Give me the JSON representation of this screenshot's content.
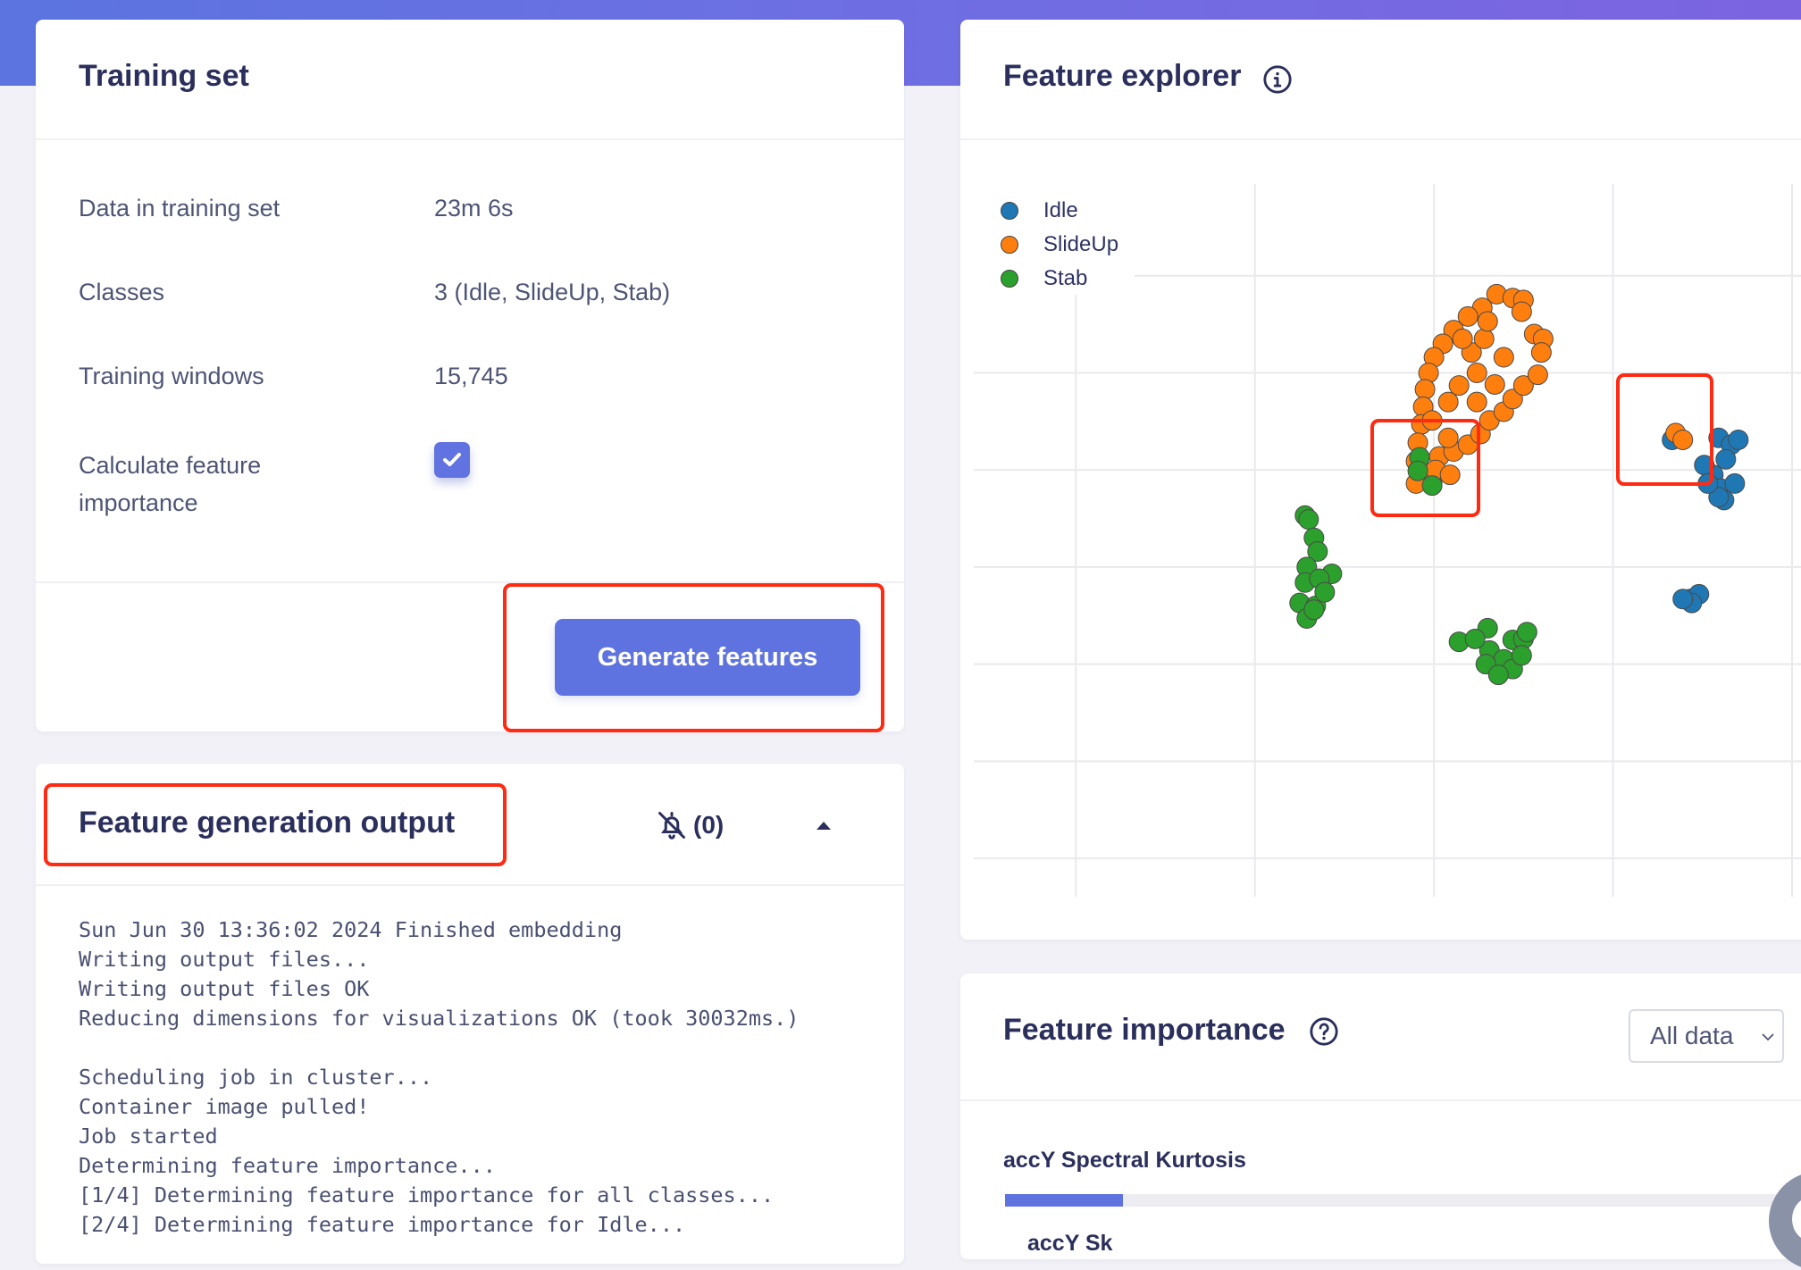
{
  "training_set": {
    "title": "Training set",
    "rows": [
      {
        "label": "Data in training set",
        "value": "23m 6s"
      },
      {
        "label": "Classes",
        "value": "3 (Idle, SlideUp, Stab)"
      },
      {
        "label": "Training windows",
        "value": "15,745"
      }
    ],
    "feature_importance_label_line1": "Calculate feature",
    "feature_importance_label_line2": "importance",
    "feature_importance_checked": true,
    "generate_button": "Generate features"
  },
  "output": {
    "title": "Feature generation output",
    "notification_icon": "bell-off-icon",
    "notification_count": "(0)",
    "collapse_icon": "caret-up-icon",
    "log_lines": [
      "Sun Jun 30 13:36:02 2024 Finished embedding",
      "Writing output files...",
      "Writing output files OK",
      "Reducing dimensions for visualizations OK (took 30032ms.)",
      "",
      "Scheduling job in cluster...",
      "Container image pulled!",
      "Job started",
      "Determining feature importance...",
      "[1/4] Determining feature importance for all classes...",
      "[2/4] Determining feature importance for Idle..."
    ]
  },
  "feature_explorer": {
    "title": "Feature explorer",
    "info_icon": "info-icon"
  },
  "feature_importance": {
    "title": "Feature importance",
    "help_icon": "help-icon",
    "filter_selected": "All data",
    "items": [
      {
        "label": "accY Spectral Kurtosis",
        "importance": 0.15
      },
      {
        "label": "accY Sk",
        "importance": null
      }
    ]
  },
  "colors": {
    "accent": "#5f73e0",
    "idle": "#1f77b4",
    "slideup": "#ff7f0e",
    "stab": "#2ca02c",
    "highlight": "#ff2a12"
  },
  "chart_data": {
    "type": "scatter",
    "title": "",
    "xlabel": "",
    "ylabel": "",
    "xlim": [
      -0.57,
      4.05
    ],
    "ylim": [
      -0.45,
      7.0
    ],
    "grid": true,
    "x_gridlines": [
      0,
      1,
      2,
      3,
      4
    ],
    "y_gridlines": [
      0,
      1,
      2,
      3,
      4,
      5,
      6
    ],
    "legend": "top-left",
    "series": [
      {
        "name": "Idle",
        "color": "#1f77b4",
        "points": [
          [
            3.33,
            4.31
          ],
          [
            3.59,
            4.33
          ],
          [
            3.66,
            4.26
          ],
          [
            3.7,
            4.31
          ],
          [
            3.63,
            4.11
          ],
          [
            3.56,
            3.95
          ],
          [
            3.6,
            3.81
          ],
          [
            3.62,
            3.69
          ],
          [
            3.59,
            3.72
          ],
          [
            3.51,
            4.05
          ],
          [
            3.53,
            3.86
          ],
          [
            3.68,
            3.86
          ],
          [
            3.43,
            2.67
          ],
          [
            3.48,
            2.72
          ],
          [
            3.44,
            2.63
          ],
          [
            3.39,
            2.67
          ]
        ]
      },
      {
        "name": "SlideUp",
        "color": "#ff7f0e",
        "points": [
          [
            2.35,
            5.81
          ],
          [
            2.44,
            5.77
          ],
          [
            2.5,
            5.75
          ],
          [
            2.27,
            5.67
          ],
          [
            2.19,
            5.58
          ],
          [
            2.11,
            5.44
          ],
          [
            2.05,
            5.3
          ],
          [
            2.0,
            5.16
          ],
          [
            1.97,
            5.0
          ],
          [
            1.95,
            4.83
          ],
          [
            1.94,
            4.65
          ],
          [
            1.93,
            4.47
          ],
          [
            1.91,
            4.28
          ],
          [
            1.9,
            4.09
          ],
          [
            2.03,
            4.14
          ],
          [
            2.11,
            4.19
          ],
          [
            2.19,
            4.26
          ],
          [
            2.26,
            4.37
          ],
          [
            2.31,
            4.51
          ],
          [
            2.39,
            4.6
          ],
          [
            2.44,
            4.73
          ],
          [
            2.5,
            4.87
          ],
          [
            2.58,
            4.98
          ],
          [
            2.56,
            5.4
          ],
          [
            2.61,
            5.35
          ],
          [
            2.6,
            5.21
          ],
          [
            2.21,
            5.21
          ],
          [
            2.24,
            5.0
          ],
          [
            2.14,
            4.87
          ],
          [
            2.08,
            4.7
          ],
          [
            1.99,
            4.51
          ],
          [
            2.24,
            4.7
          ],
          [
            2.34,
            4.88
          ],
          [
            2.28,
            5.35
          ],
          [
            2.39,
            5.16
          ],
          [
            2.16,
            5.35
          ],
          [
            2.3,
            5.53
          ],
          [
            1.99,
            3.86
          ],
          [
            2.01,
            4.0
          ],
          [
            2.09,
            3.95
          ],
          [
            1.9,
            3.86
          ],
          [
            2.08,
            4.33
          ],
          [
            2.49,
            5.63
          ],
          [
            3.35,
            4.38
          ],
          [
            3.39,
            4.31
          ]
        ]
      },
      {
        "name": "Stab",
        "color": "#2ca02c",
        "points": [
          [
            1.92,
            4.13
          ],
          [
            1.91,
            3.99
          ],
          [
            1.99,
            3.84
          ],
          [
            1.28,
            3.53
          ],
          [
            1.3,
            3.49
          ],
          [
            1.33,
            3.3
          ],
          [
            1.35,
            3.16
          ],
          [
            1.29,
            3.0
          ],
          [
            1.43,
            2.93
          ],
          [
            1.28,
            2.84
          ],
          [
            1.36,
            2.88
          ],
          [
            1.25,
            2.63
          ],
          [
            1.34,
            2.6
          ],
          [
            1.29,
            2.47
          ],
          [
            1.33,
            2.56
          ],
          [
            1.39,
            2.74
          ],
          [
            2.14,
            2.23
          ],
          [
            2.3,
            2.37
          ],
          [
            2.44,
            2.25
          ],
          [
            2.5,
            2.26
          ],
          [
            2.31,
            2.14
          ],
          [
            2.39,
            2.05
          ],
          [
            2.29,
            2.0
          ],
          [
            2.44,
            1.95
          ],
          [
            2.49,
            2.09
          ],
          [
            2.36,
            1.89
          ],
          [
            2.23,
            2.26
          ],
          [
            2.52,
            2.33
          ]
        ]
      }
    ]
  }
}
